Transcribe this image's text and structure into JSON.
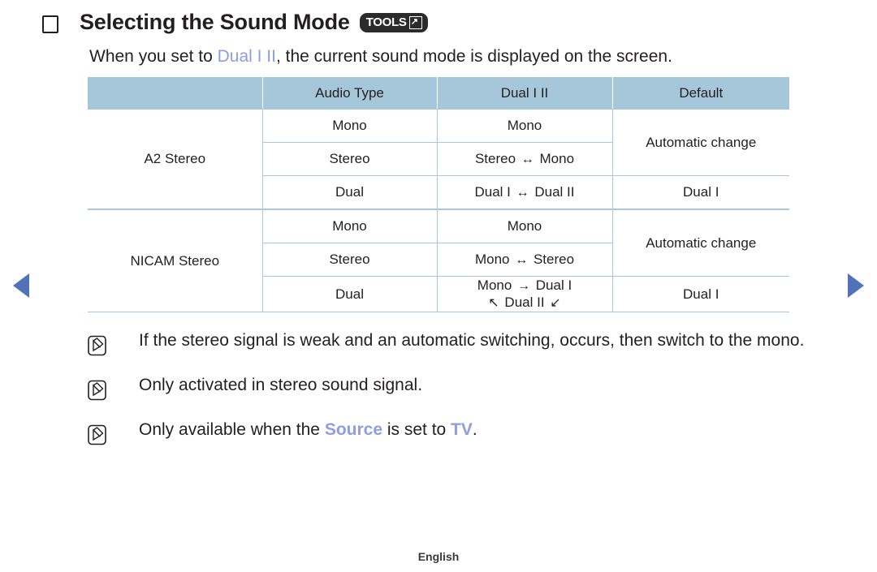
{
  "nav": {
    "prev_label": "previous page",
    "next_label": "next page",
    "arrow_color": "#5272b8"
  },
  "heading": {
    "title": "Selecting the Sound Mode",
    "badge_label": "TOOLS",
    "badge_icon": "external-link-icon"
  },
  "intro": {
    "before": "When you set to ",
    "highlight": "Dual I II",
    "after": ", the current sound mode is displayed on the screen."
  },
  "table": {
    "headers": [
      "",
      "Audio Type",
      "Dual I II",
      "Default"
    ],
    "header_bg": "#a6c6da",
    "border_color": "#a8c8e0",
    "accent_color": "#8c9ee0",
    "groups": [
      {
        "name": "A2 Stereo",
        "rows": [
          {
            "audio_type": "Mono",
            "dual": {
              "parts": [
                {
                  "t": "Mono",
                  "c": "blue"
                }
              ]
            },
            "default": {
              "text": "Automatic change",
              "c": "black",
              "rowspan": 2
            }
          },
          {
            "audio_type": "Stereo",
            "dual": {
              "parts": [
                {
                  "t": "Stereo",
                  "c": "blue"
                },
                {
                  "t": "↔",
                  "c": "black"
                },
                {
                  "t": "Mono",
                  "c": "blue"
                }
              ]
            }
          },
          {
            "audio_type": "Dual",
            "dual": {
              "parts": [
                {
                  "t": "Dual I",
                  "c": "blue"
                },
                {
                  "t": "↔",
                  "c": "black"
                },
                {
                  "t": "Dual II",
                  "c": "blue"
                }
              ]
            },
            "default": {
              "text": "Dual I",
              "c": "blue",
              "rowspan": 1
            }
          }
        ]
      },
      {
        "name": "NICAM Stereo",
        "rows": [
          {
            "audio_type": "Mono",
            "dual": {
              "parts": [
                {
                  "t": "Mono",
                  "c": "blue"
                }
              ]
            },
            "default": {
              "text": "Automatic change",
              "c": "black",
              "rowspan": 2
            }
          },
          {
            "audio_type": "Stereo",
            "dual": {
              "parts": [
                {
                  "t": "Mono",
                  "c": "blue"
                },
                {
                  "t": "↔",
                  "c": "black"
                },
                {
                  "t": "Stereo",
                  "c": "blue"
                }
              ]
            }
          },
          {
            "audio_type": "Dual",
            "dual": {
              "line1": [
                {
                  "t": "Mono",
                  "c": "blue"
                },
                {
                  "t": "→",
                  "c": "black"
                },
                {
                  "t": "Dual I",
                  "c": "blue"
                }
              ],
              "line2": [
                {
                  "t": "↖",
                  "c": "black"
                },
                {
                  "t": "Dual II",
                  "c": "blue"
                },
                {
                  "t": "↙",
                  "c": "black"
                }
              ]
            },
            "default": {
              "text": "Dual I",
              "c": "blue",
              "rowspan": 1
            }
          }
        ]
      }
    ]
  },
  "notes": [
    {
      "icon": "note-pencil-icon",
      "segments": [
        {
          "t": "If the stereo signal is weak and an automatic switching, occurs, then switch to the mono.",
          "c": "black"
        }
      ]
    },
    {
      "icon": "note-pencil-icon",
      "segments": [
        {
          "t": "Only activated in stereo sound signal.",
          "c": "black"
        }
      ]
    },
    {
      "icon": "note-pencil-icon",
      "segments": [
        {
          "t": "Only available when the ",
          "c": "black"
        },
        {
          "t": "Source",
          "c": "blue-bold"
        },
        {
          "t": " is set to ",
          "c": "black"
        },
        {
          "t": "TV",
          "c": "blue-bold"
        },
        {
          "t": ".",
          "c": "black"
        }
      ]
    }
  ],
  "footer": {
    "language": "English"
  }
}
